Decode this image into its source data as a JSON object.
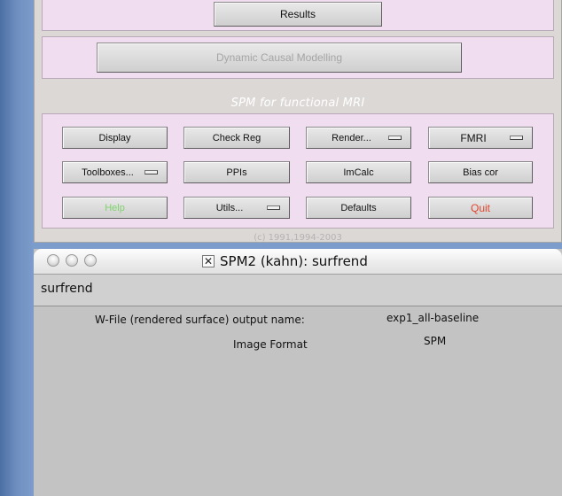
{
  "spm_window": {
    "top_buttons": {
      "results": "Results",
      "dcm": "Dynamic Causal Modelling"
    },
    "caption": "SPM for functional MRI",
    "buttons": {
      "display": "Display",
      "check_reg": "Check Reg",
      "render": "Render...",
      "fmri": "FMRI",
      "toolboxes": "Toolboxes...",
      "ppis": "PPIs",
      "imcalc": "ImCalc",
      "bias_cor": "Bias cor",
      "help": "Help",
      "utils": "Utils...",
      "defaults": "Defaults",
      "quit": "Quit"
    },
    "copyright": "(c) 1991,1994-2003",
    "colors": {
      "panel_bg": "#f0ddef",
      "help_text": "#7fd36b",
      "quit_text": "#e2452e"
    }
  },
  "dialog_window": {
    "title": "SPM2 (kahn): surfrend",
    "title_icon": "x11-icon",
    "subheader": "surfrend",
    "fields": [
      {
        "label": "W-File (rendered surface) output name:",
        "value": "exp1_all-baseline"
      },
      {
        "label": "Image Format",
        "value": "SPM"
      }
    ]
  }
}
